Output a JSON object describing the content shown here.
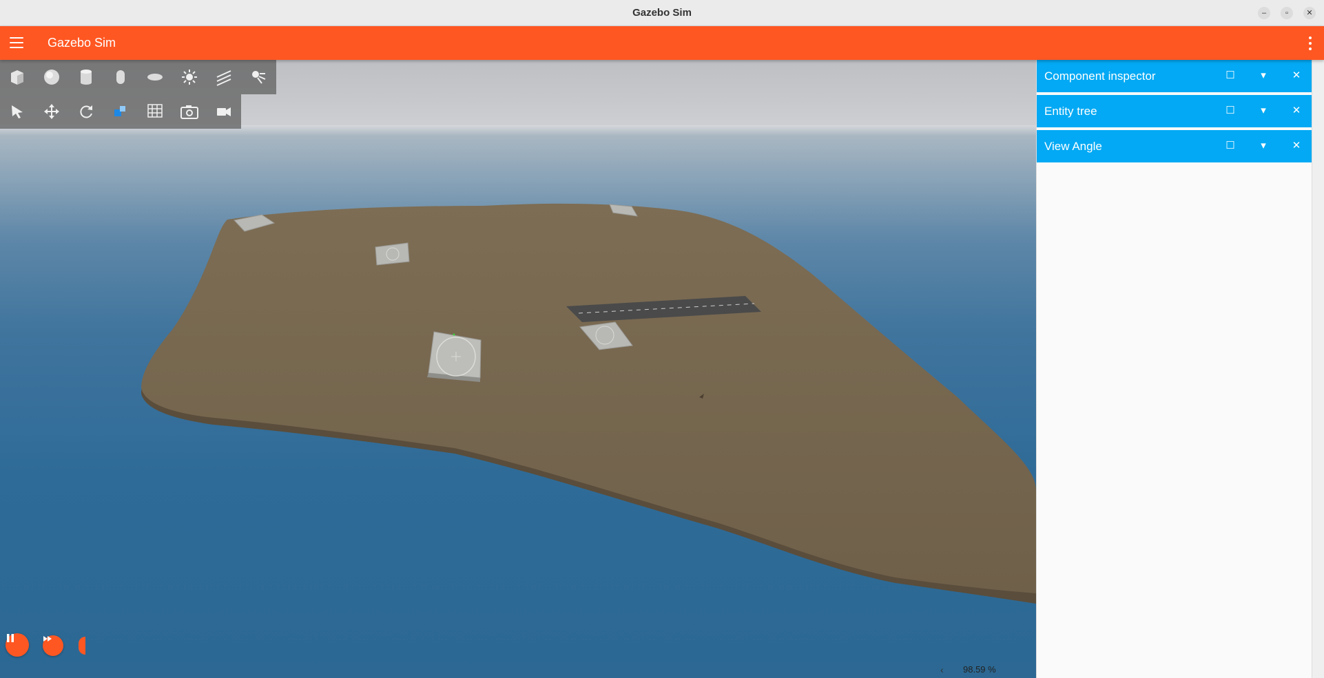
{
  "window": {
    "title": "Gazebo Sim",
    "minimize_glyph": "–",
    "maximize_glyph": "▫",
    "close_glyph": "✕"
  },
  "appbar": {
    "title": "Gazebo Sim",
    "menu_icon": "hamburger-menu-icon",
    "options_icon": "more-vert-icon"
  },
  "toolbar_shapes": {
    "items": [
      "box-icon",
      "sphere-icon",
      "cylinder-icon",
      "capsule-icon",
      "ellipsoid-icon",
      "point-light-icon",
      "directional-light-icon",
      "spot-light-icon"
    ]
  },
  "toolbar_transform": {
    "items": [
      "select-icon",
      "translate-icon",
      "rotate-icon",
      "scale-icon",
      "grid-snap-icon",
      "screenshot-icon",
      "video-record-icon"
    ]
  },
  "playback": {
    "play_pause_icon": "pause-icon",
    "step_icon": "fast-forward-icon"
  },
  "stats": {
    "real_time_factor": "98.59 %",
    "expand_glyph": "‹"
  },
  "panels": [
    {
      "title": "Component inspector"
    },
    {
      "title": "Entity tree"
    },
    {
      "title": "View Angle"
    }
  ],
  "panel_buttons": {
    "float_glyph": "☐",
    "collapse_glyph": "▾",
    "close_glyph": "✕"
  },
  "colors": {
    "accent": "#ff5722",
    "panel_title": "#03a9f4",
    "island": "#7a6a52",
    "water": "#2f6b98"
  }
}
